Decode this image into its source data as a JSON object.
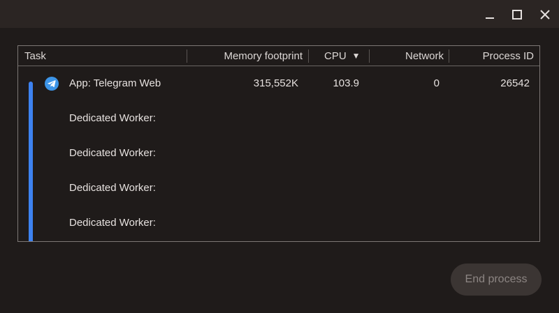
{
  "window": {
    "controls": {
      "minimize_icon": "minimize-icon",
      "maximize_icon": "maximize-icon",
      "close_icon": "close-icon"
    }
  },
  "table": {
    "columns": {
      "task": "Task",
      "memory": "Memory footprint",
      "cpu": "CPU",
      "cpu_sort": "▼",
      "network": "Network",
      "pid": "Process ID"
    },
    "rows": [
      {
        "task": "App: Telegram Web",
        "memory": "315,552K",
        "cpu": "103.9",
        "network": "0",
        "pid": "26542",
        "icon": "telegram-icon"
      },
      {
        "task": "Dedicated Worker:"
      },
      {
        "task": "Dedicated Worker:"
      },
      {
        "task": "Dedicated Worker:"
      },
      {
        "task": "Dedicated Worker:"
      }
    ]
  },
  "actions": {
    "end_process": "End process"
  },
  "colors": {
    "accent": "#3d82f0",
    "background": "#1f1b1a",
    "titlebar": "#2b2523",
    "button_disabled_bg": "#3b3533",
    "button_disabled_text": "#8c8583"
  }
}
